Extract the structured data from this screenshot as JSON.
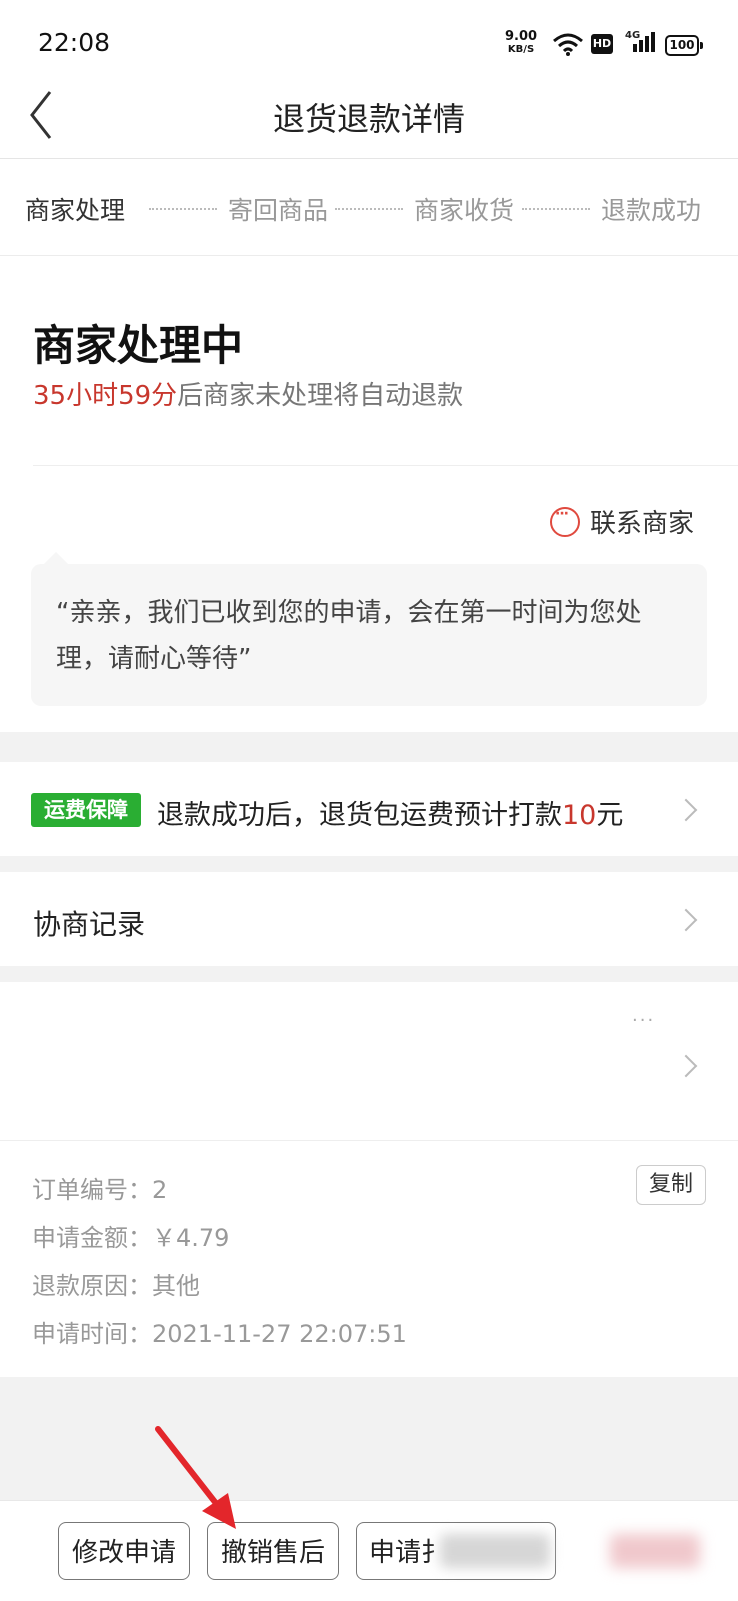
{
  "status_bar": {
    "time": "22:08",
    "net_speed": "9.00",
    "net_unit": "KB/S",
    "hd": "HD",
    "signal": "4G",
    "battery": "100"
  },
  "header": {
    "title": "退货退款详情"
  },
  "steps": [
    "商家处理",
    "寄回商品",
    "商家收货",
    "退款成功"
  ],
  "status": {
    "title": "商家处理中",
    "countdown": "35小时59分",
    "countdown_suffix": "后商家未处理将自动退款"
  },
  "contact": {
    "label": "联系商家"
  },
  "message": "“亲亲，我们已收到您的申请，会在第一时间为您处理，请耐心等待”",
  "shipping": {
    "badge": "运费保障",
    "text_before": "退款成功后，退货包运费预计打款",
    "amount": "10",
    "unit": "元"
  },
  "negotiation": {
    "label": "协商记录"
  },
  "product": {
    "more": "···"
  },
  "order_info": {
    "order_no": "订单编号：2",
    "amount": "申请金额：￥4.79",
    "reason": "退款原因：其他",
    "time": "申请时间：2021-11-27 22:07:51",
    "copy_label": "复制"
  },
  "actions": {
    "modify": "修改申请",
    "cancel": "撤销售后",
    "apply_partial": "申请扌"
  },
  "colors": {
    "accent_red": "#c8372d",
    "badge_green": "#2aae33",
    "arrow_red": "#e3262b"
  }
}
